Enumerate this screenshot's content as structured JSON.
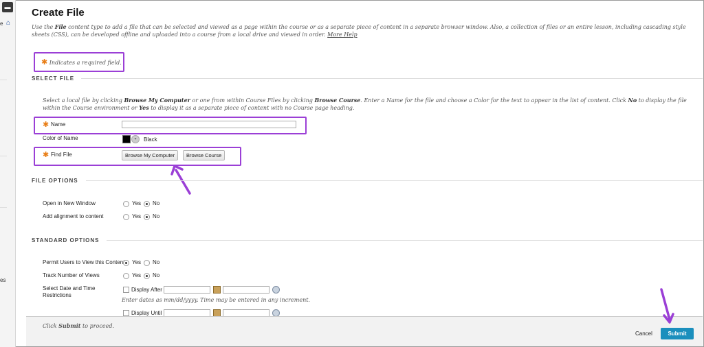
{
  "page": {
    "title": "Create File",
    "intro_parts": [
      "Use the ",
      "File",
      " content type to add a file that can be selected and viewed as a page within the course or as a separate piece of content in a separate browser window. Also, a collection of files or an entire lesson, including cascading style sheets (CSS), can be developed offline and uploaded into a course from a local drive and viewed in order. "
    ],
    "more_help": "More Help",
    "required_note": "Indicates a required field.",
    "required_star": "✱"
  },
  "leftbar": {
    "cut_text_e": "e",
    "cut_text_es": "es"
  },
  "select_file": {
    "heading": "SELECT FILE",
    "desc_parts": [
      "Select a local file by clicking ",
      "Browse My Computer",
      " or one from within Course Files by clicking ",
      "Browse Course",
      ". Enter a Name for the file and choose a Color for the text to appear in the list of content. Click ",
      "No",
      " to display the file within the Course environment or ",
      "Yes",
      " to display it as a separate piece of content with no Course page heading."
    ],
    "name_label": "Name",
    "name_value": "",
    "color_label": "Color of Name",
    "color_value": "Black",
    "color_hex": "#000000",
    "find_file_label": "Find File",
    "browse_my_computer": "Browse My Computer",
    "browse_course": "Browse Course"
  },
  "file_options": {
    "heading": "FILE OPTIONS",
    "open_new_window_label": "Open in New Window",
    "open_new_window_value": "No",
    "alignment_label": "Add alignment to content",
    "alignment_value": "No",
    "yes": "Yes",
    "no": "No"
  },
  "standard_options": {
    "heading": "STANDARD OPTIONS",
    "permit_label": "Permit Users to View this Content",
    "permit_value": "Yes",
    "track_label": "Track Number of Views",
    "track_value": "No",
    "date_label": "Select Date and Time Restrictions",
    "display_after": "Display After",
    "display_until": "Display Until",
    "date_hint": "Enter dates as mm/dd/yyyy. Time may be entered in any increment.",
    "yes": "Yes",
    "no": "No"
  },
  "footer": {
    "proceed_parts": [
      "Click ",
      "Submit",
      " to proceed."
    ],
    "cancel": "Cancel",
    "submit": "Submit"
  },
  "colors": {
    "highlight": "#9b3fd6",
    "submit_bg": "#1b8fbd",
    "required_star": "#e87c13"
  }
}
